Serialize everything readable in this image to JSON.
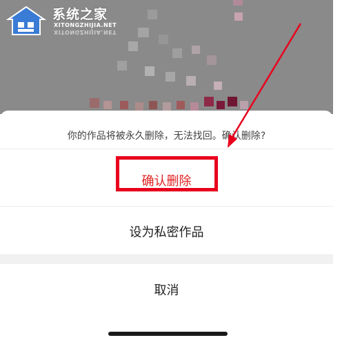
{
  "watermark": {
    "title": "系统之家",
    "subtitle": "XITONGZHIJIA.NET",
    "subtitle_mirrored": "XITONGZHIJIA.NET"
  },
  "dialog": {
    "prompt": "你的作品将被永久删除，无法找回。确认删除?",
    "confirm_label": "确认删除",
    "private_label": "设为私密作品",
    "cancel_label": "取消"
  },
  "colors": {
    "confirm_text": "#e02020",
    "annotation": "#e8001c",
    "backdrop": "#8a8a8a"
  },
  "icons": {
    "watermark_logo": "house-logo-icon",
    "annotation_arrow": "red-arrow-icon"
  }
}
